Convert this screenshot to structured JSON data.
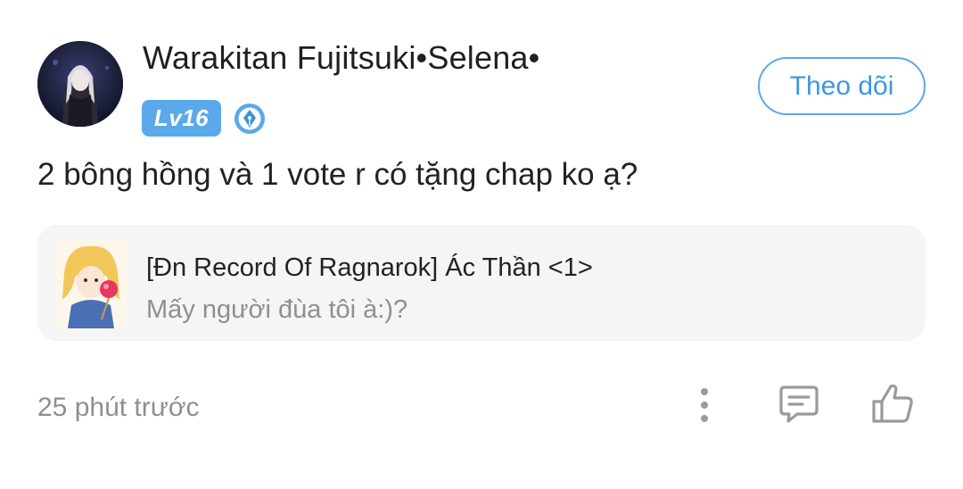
{
  "post": {
    "author": {
      "name": "Warakitan Fujitsuki•Selena•",
      "level_badge": "Lv16",
      "badge_color": "#5aa9ea"
    },
    "follow_label": "Theo dõi",
    "comment_text": "2 bông hồng và 1 vote r có tặng chap ko ạ?",
    "story": {
      "title": "[Đn Record Of Ragnarok] Ác Thần <1>",
      "subtitle": "Mấy người đùa tôi à:)?"
    },
    "timestamp": "25 phút trước",
    "actions": {
      "more_icon": "more-vertical-icon",
      "comment_icon": "comment-icon",
      "like_icon": "thumbs-up-icon"
    },
    "colors": {
      "accent": "#5aa9ea",
      "text_primary": "#222222",
      "text_secondary": "#8f8f8f",
      "card_background": "#f5f5f5",
      "icon_gray": "#9a9a9a"
    }
  }
}
